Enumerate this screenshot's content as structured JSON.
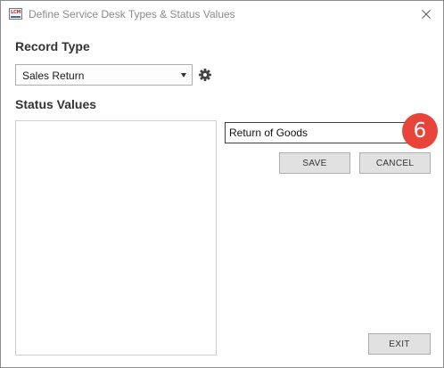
{
  "window": {
    "app_icon": "lcm-app-icon",
    "app_icon_text": "LCM",
    "title": "Define Service Desk Types & Status Values",
    "close_icon": "close-icon"
  },
  "record_type": {
    "label": "Record Type",
    "selected": "Sales Return",
    "settings_icon": "gear-icon"
  },
  "status_values": {
    "label": "Status Values",
    "items": []
  },
  "editor": {
    "input_value": "Return of Goods",
    "step_badge": "6",
    "badge_color": "#e8443a",
    "save_label": "SAVE",
    "cancel_label": "CANCEL"
  },
  "footer": {
    "exit_label": "EXIT"
  }
}
